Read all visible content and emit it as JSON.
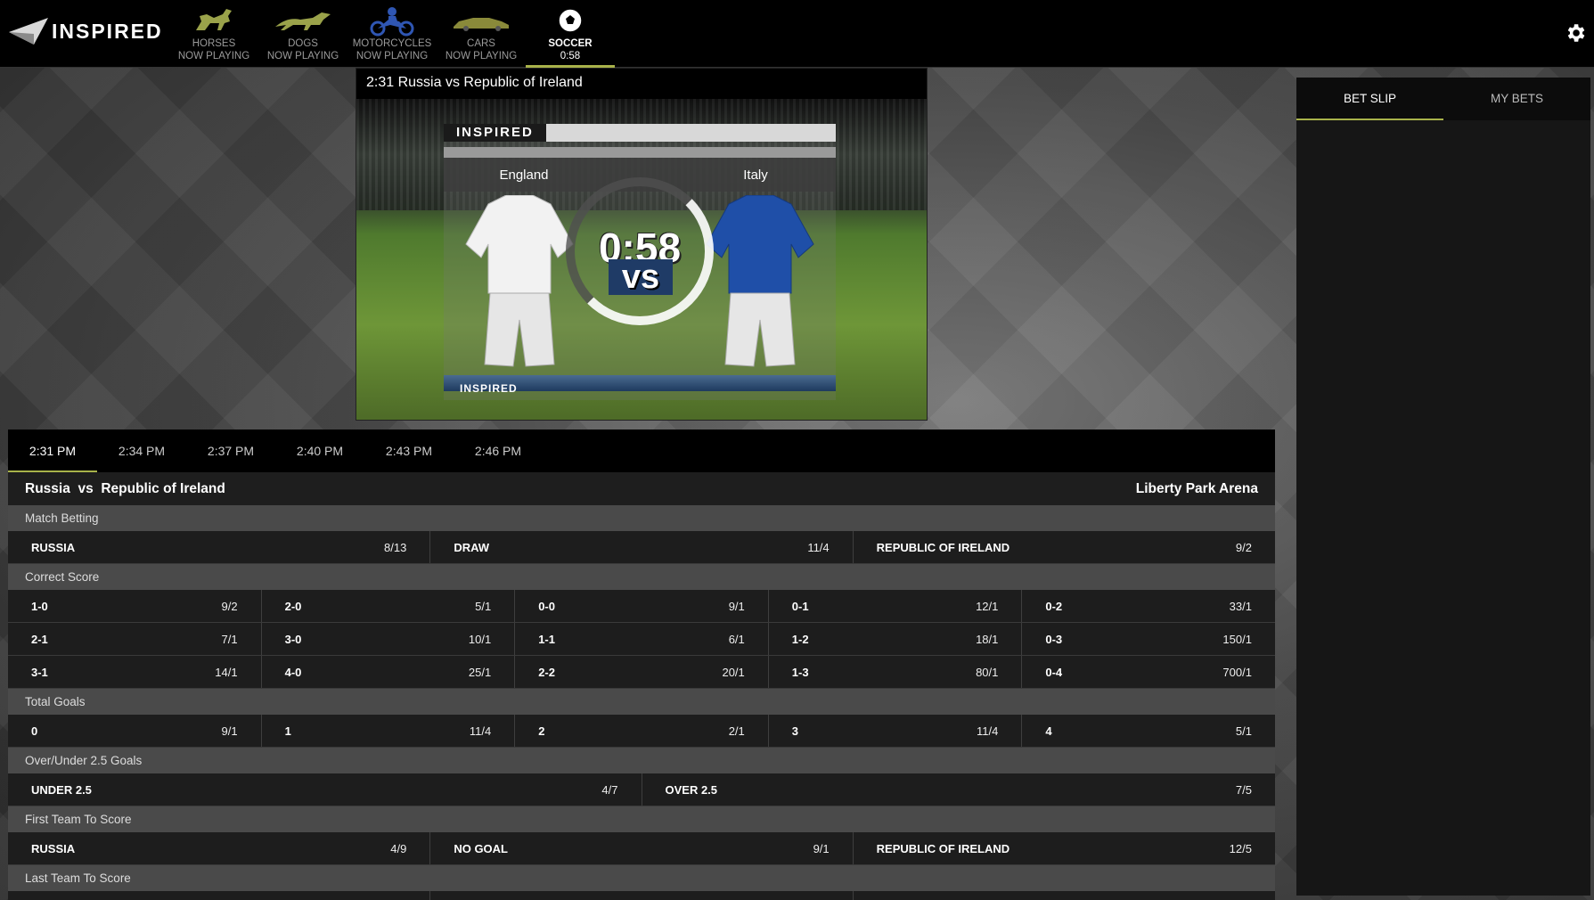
{
  "brand": {
    "name": "INSPIRED"
  },
  "categories": [
    {
      "name": "HORSES",
      "status": "NOW PLAYING",
      "icon": "horse-icon",
      "color": "#9aa24a"
    },
    {
      "name": "DOGS",
      "status": "NOW PLAYING",
      "icon": "greyhound-icon",
      "color": "#9aa24a"
    },
    {
      "name": "MOTORCYCLES",
      "status": "NOW PLAYING",
      "icon": "motorcycle-icon",
      "color": "#2f56b3"
    },
    {
      "name": "CARS",
      "status": "NOW PLAYING",
      "icon": "car-icon",
      "color": "#9aa24a"
    },
    {
      "name": "SOCCER",
      "status": "0:58",
      "icon": "soccer-ball-icon",
      "color": "#ffffff"
    }
  ],
  "video": {
    "title": "2:31 Russia vs Republic of Ireland",
    "brand_top": "INSPIRED",
    "brand_bottom": "INSPIRED",
    "team_home": "England",
    "team_away": "Italy",
    "countdown": "0:58",
    "vs": "vs"
  },
  "betslip": {
    "tabs": [
      "BET SLIP",
      "MY BETS"
    ]
  },
  "times": [
    "2:31 PM",
    "2:34 PM",
    "2:37 PM",
    "2:40 PM",
    "2:43 PM",
    "2:46 PM"
  ],
  "match": {
    "home": "Russia",
    "vs": "vs",
    "away": "Republic of Ireland",
    "venue": "Liberty Park Arena"
  },
  "markets": {
    "match_betting": {
      "title": "Match Betting",
      "row": [
        {
          "label": "RUSSIA",
          "price": "8/13"
        },
        {
          "label": "DRAW",
          "price": "11/4"
        },
        {
          "label": "REPUBLIC OF IRELAND",
          "price": "9/2"
        }
      ]
    },
    "correct_score": {
      "title": "Correct Score",
      "rows": [
        [
          {
            "label": "1-0",
            "price": "9/2"
          },
          {
            "label": "2-0",
            "price": "5/1"
          },
          {
            "label": "0-0",
            "price": "9/1"
          },
          {
            "label": "0-1",
            "price": "12/1"
          },
          {
            "label": "0-2",
            "price": "33/1"
          }
        ],
        [
          {
            "label": "2-1",
            "price": "7/1"
          },
          {
            "label": "3-0",
            "price": "10/1"
          },
          {
            "label": "1-1",
            "price": "6/1"
          },
          {
            "label": "1-2",
            "price": "18/1"
          },
          {
            "label": "0-3",
            "price": "150/1"
          }
        ],
        [
          {
            "label": "3-1",
            "price": "14/1"
          },
          {
            "label": "4-0",
            "price": "25/1"
          },
          {
            "label": "2-2",
            "price": "20/1"
          },
          {
            "label": "1-3",
            "price": "80/1"
          },
          {
            "label": "0-4",
            "price": "700/1"
          }
        ]
      ]
    },
    "total_goals": {
      "title": "Total Goals",
      "row": [
        {
          "label": "0",
          "price": "9/1"
        },
        {
          "label": "1",
          "price": "11/4"
        },
        {
          "label": "2",
          "price": "2/1"
        },
        {
          "label": "3",
          "price": "11/4"
        },
        {
          "label": "4",
          "price": "5/1"
        }
      ]
    },
    "over_under": {
      "title": "Over/Under 2.5 Goals",
      "row": [
        {
          "label": "UNDER 2.5",
          "price": "4/7"
        },
        {
          "label": "OVER 2.5",
          "price": "7/5"
        }
      ]
    },
    "first_team": {
      "title": "First Team To Score",
      "row": [
        {
          "label": "RUSSIA",
          "price": "4/9"
        },
        {
          "label": "NO GOAL",
          "price": "9/1"
        },
        {
          "label": "REPUBLIC OF IRELAND",
          "price": "12/5"
        }
      ]
    },
    "last_team": {
      "title": "Last Team To Score"
    }
  },
  "colors": {
    "accent": "#a8b24a",
    "header_bg": "#000000",
    "row_bg": "#1d1d1d",
    "section_bg": "#4a4a4a"
  }
}
